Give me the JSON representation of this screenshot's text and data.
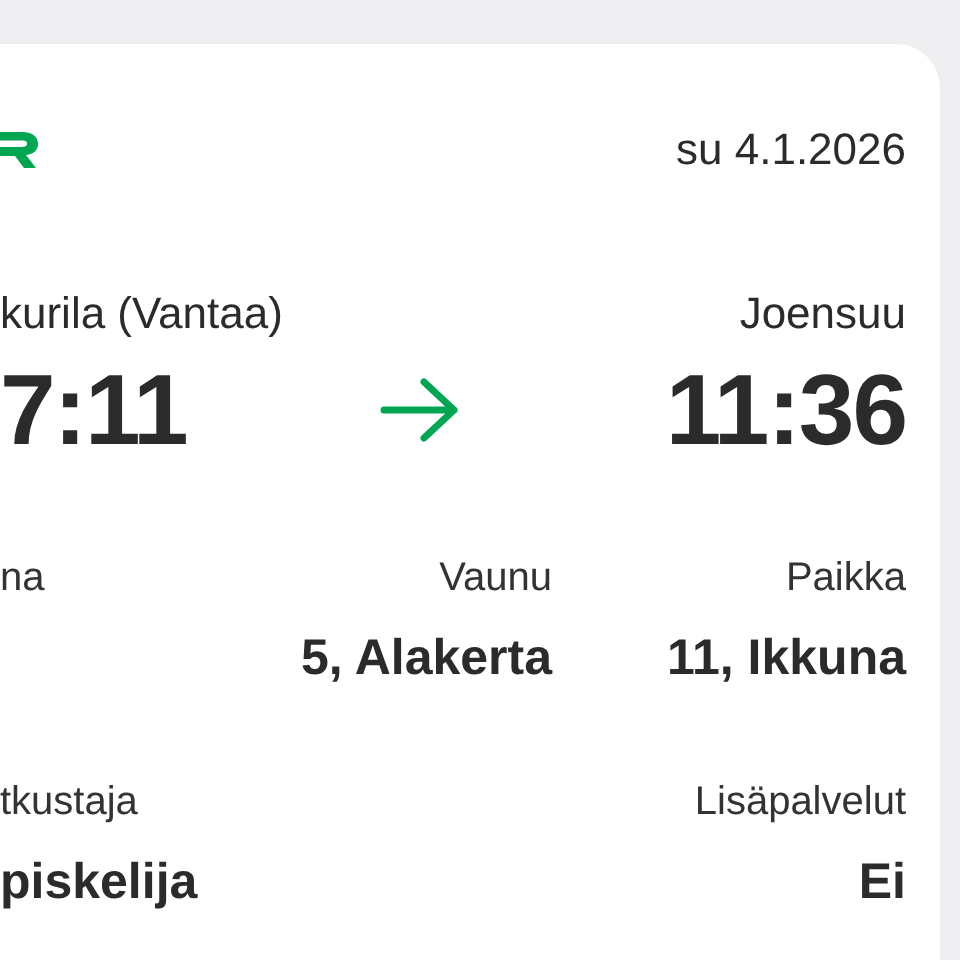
{
  "header": {
    "date": "su 4.1.2026"
  },
  "route": {
    "from": {
      "station": "kurila (Vantaa)",
      "time": "7:11"
    },
    "to": {
      "station": "Joensuu",
      "time": "11:36"
    }
  },
  "details": [
    [
      {
        "label": "na"
      },
      {
        "label": "Vaunu",
        "value": "5, Alakerta"
      },
      {
        "label": "Paikka",
        "value": "11, Ikkuna"
      }
    ],
    [
      {
        "label": "tkustaja",
        "value": "piskelija"
      },
      {
        "label": "Lisäpalvelut",
        "value": "Ei"
      }
    ]
  ]
}
